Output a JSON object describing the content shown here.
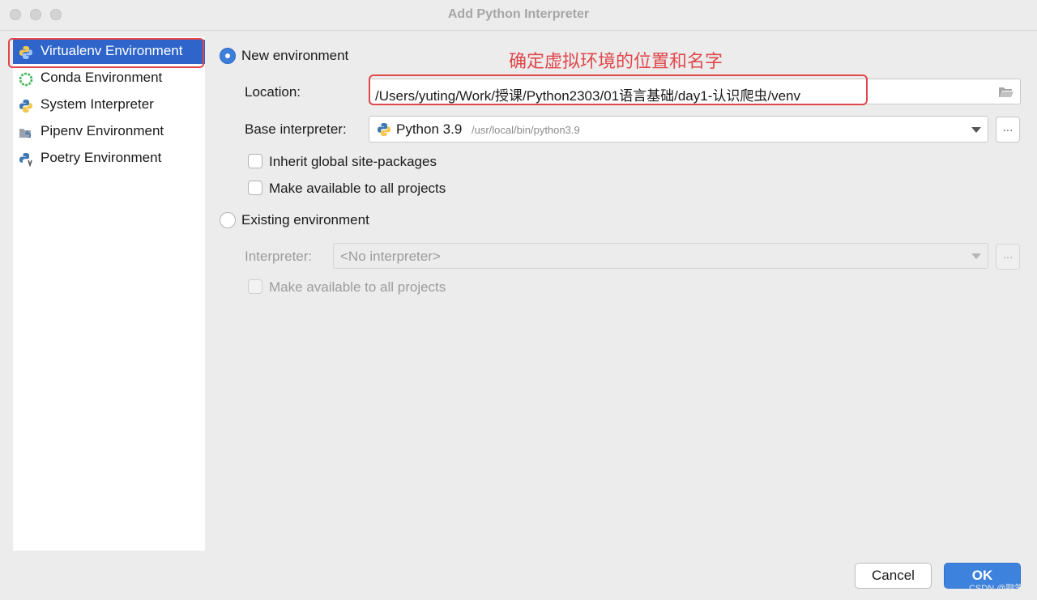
{
  "window": {
    "title": "Add Python Interpreter"
  },
  "sidebar": {
    "items": [
      {
        "label": "Virtualenv Environment",
        "icon": "virtualenv-icon",
        "selected": true
      },
      {
        "label": "Conda Environment",
        "icon": "conda-icon"
      },
      {
        "label": "System Interpreter",
        "icon": "python-icon"
      },
      {
        "label": "Pipenv Environment",
        "icon": "pipenv-icon"
      },
      {
        "label": "Poetry Environment",
        "icon": "poetry-icon"
      }
    ]
  },
  "new_env": {
    "radio_label": "New environment",
    "selected": true,
    "location_label": "Location:",
    "location_value": "/Users/yuting/Work/授课/Python2303/01语言基础/day1-认识爬虫/venv",
    "base_label": "Base interpreter:",
    "base_name": "Python 3.9",
    "base_path": "/usr/local/bin/python3.9",
    "inherit_label": "Inherit global site-packages",
    "make_available_label": "Make available to all projects",
    "more_button": "..."
  },
  "existing_env": {
    "radio_label": "Existing environment",
    "interpreter_label": "Interpreter:",
    "interpreter_value": "<No interpreter>",
    "make_available_label": "Make available to all projects",
    "more_button": "..."
  },
  "annotation": {
    "text": "确定虚拟环境的位置和名字",
    "color": "#e0474c"
  },
  "buttons": {
    "cancel": "Cancel",
    "ok": "OK"
  },
  "watermark": "CSDN @聊笑",
  "colors": {
    "selection": "#2f65ca",
    "accent": "#3d83de",
    "highlight_box": "#e0474c"
  }
}
